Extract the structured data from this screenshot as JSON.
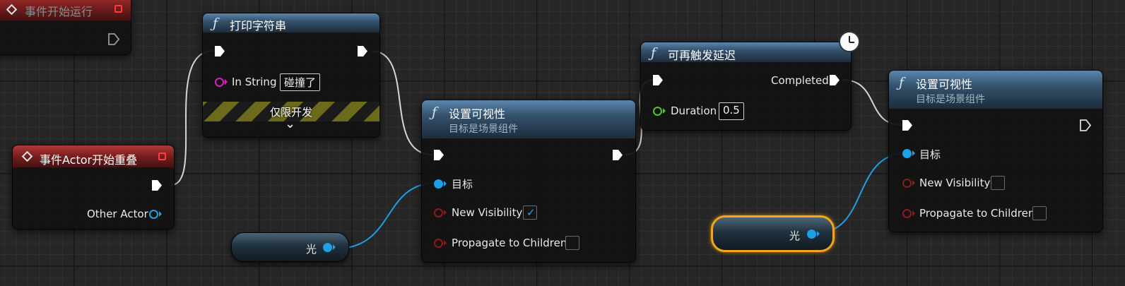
{
  "nodes": {
    "begin_play": {
      "title": "事件开始运行"
    },
    "print_string": {
      "title": "打印字符串",
      "in_string_label": "In String",
      "in_string_value": "碰撞了",
      "dev_only_label": "仅限开发",
      "expand_glyph": "⌄"
    },
    "overlap_event": {
      "title": "事件Actor开始重叠",
      "other_actor_label": "Other Actor"
    },
    "set_visibility_1": {
      "title": "设置可视性",
      "subtitle": "目标是场景组件",
      "target_label": "目标",
      "new_visibility_label": "New Visibility",
      "new_visibility_checked": true,
      "propagate_label": "Propagate to Children",
      "propagate_checked": false
    },
    "retriggerable_delay": {
      "title": "可再触发延迟",
      "completed_label": "Completed",
      "duration_label": "Duration",
      "duration_value": "0.5"
    },
    "set_visibility_2": {
      "title": "设置可视性",
      "subtitle": "目标是场景组件",
      "target_label": "目标",
      "new_visibility_label": "New Visibility",
      "new_visibility_checked": false,
      "propagate_label": "Propagate to Children",
      "propagate_checked": false
    },
    "light_var_1": {
      "label": "光"
    },
    "light_var_2": {
      "label": "光",
      "selected": true
    }
  },
  "function_icon": "ƒ",
  "check_glyph": "✓",
  "colors": {
    "exec_wire": "#d8d8d8",
    "object_wire": "#1ea0e6",
    "function_header": "#34526d",
    "event_header": "#7c1f1f",
    "selection": "#f2a520",
    "bool_pin": "#8c1c1c",
    "float_pin": "#4fc23a",
    "string_pin": "#d620b7"
  }
}
